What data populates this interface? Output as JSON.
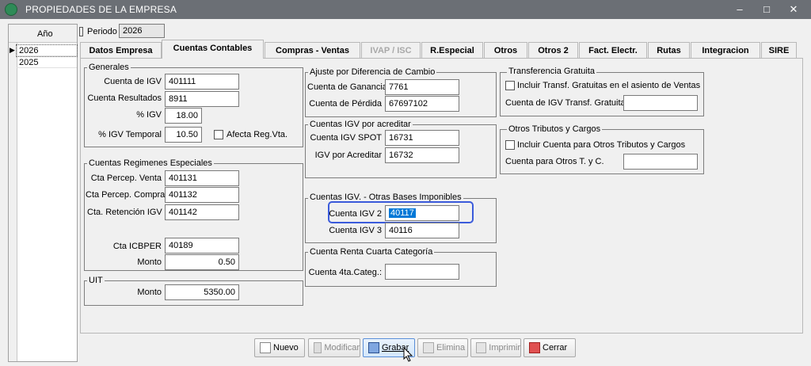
{
  "window": {
    "title": "PROPIEDADES DE LA EMPRESA",
    "controls": [
      "minimize-icon",
      "maximize-icon",
      "close-icon"
    ]
  },
  "years": {
    "header": "Año",
    "rows": [
      "2026",
      "2025"
    ],
    "selected": "2026"
  },
  "periodo": {
    "label": "Periodo",
    "value": "2026"
  },
  "tabs": [
    {
      "label": "Datos Empresa",
      "state": "normal"
    },
    {
      "label": "Cuentas Contables",
      "state": "active"
    },
    {
      "label": "Compras - Ventas",
      "state": "normal"
    },
    {
      "label": "IVAP / ISC",
      "state": "disabled"
    },
    {
      "label": "R.Especial",
      "state": "normal"
    },
    {
      "label": "Otros",
      "state": "normal"
    },
    {
      "label": "Otros 2",
      "state": "normal"
    },
    {
      "label": "Fact. Electr.",
      "state": "normal"
    },
    {
      "label": "Rutas",
      "state": "normal"
    },
    {
      "label": "Integracion",
      "state": "normal"
    },
    {
      "label": "SIRE",
      "state": "normal"
    }
  ],
  "generales": {
    "title": "Generales",
    "cuenta_igv": {
      "label": "Cuenta de IGV",
      "value": "401111"
    },
    "cuenta_resultados": {
      "label": "Cuenta Resultados",
      "value": "8911"
    },
    "pct_igv": {
      "label": "% IGV",
      "value": "18.00"
    },
    "pct_igv_temporal": {
      "label": "% IGV Temporal",
      "value": "10.50"
    },
    "afecta_reg_vta": {
      "label": "Afecta Reg.Vta.",
      "checked": false
    }
  },
  "regimenes": {
    "title": "Cuentas Regimenes Especiales",
    "percep_venta": {
      "label": "Cta Percep. Venta",
      "value": "401131"
    },
    "percep_compra": {
      "label": "Cta Percep. Compra",
      "value": "401132"
    },
    "retencion_igv": {
      "label": "Cta. Retención IGV",
      "value": "401142"
    },
    "icbper": {
      "label": "Cta ICBPER",
      "value": "40189"
    },
    "monto": {
      "label": "Monto",
      "value": "0.50"
    }
  },
  "uit": {
    "title": "UIT",
    "monto": {
      "label": "Monto",
      "value": "5350.00"
    }
  },
  "ajuste": {
    "title": "Ajuste por Diferencia de Cambio",
    "ganancia": {
      "label": "Cuenta de Ganancia",
      "value": "7761"
    },
    "perdida": {
      "label": "Cuenta de Pérdida",
      "value": "67697102"
    }
  },
  "por_acreditar": {
    "title": "Cuentas IGV por acreditar",
    "spot": {
      "label": "Cuenta IGV SPOT",
      "value": "16731"
    },
    "acreditar": {
      "label": "IGV por Acreditar",
      "value": "16732"
    }
  },
  "otras_bases": {
    "title": "Cuentas IGV. - Otras Bases Imponibles",
    "igv2": {
      "label": "Cuenta IGV 2",
      "value": "40117"
    },
    "igv3": {
      "label": "Cuenta IGV 3",
      "value": "40116"
    }
  },
  "renta": {
    "title": "Cuenta Renta Cuarta Categoría",
    "cuarta": {
      "label": "Cuenta 4ta.Categ.:",
      "value": ""
    }
  },
  "transferencia": {
    "title": "Transferencia Gratuita",
    "incluir": {
      "label": "Incluir Transf. Gratuitas en el asiento de Ventas",
      "checked": false
    },
    "cuenta": {
      "label": "Cuenta de IGV Transf. Gratuita",
      "value": ""
    }
  },
  "otros_tributos": {
    "title": "Otros Tributos y Cargos",
    "incluir": {
      "label": "Incluir Cuenta para Otros Tributos y Cargos",
      "checked": false
    },
    "cuenta": {
      "label": "Cuenta para Otros T. y C.",
      "value": ""
    }
  },
  "buttons": {
    "nuevo": "Nuevo",
    "modificar": "Modificar",
    "grabar": "Grabar",
    "elimina": "Elimina",
    "imprimir": "Imprimir",
    "cerrar": "Cerrar"
  },
  "colors": {
    "titlebar": "#6b6f75",
    "selection": "#0078d7",
    "focus_ring": "#3b5bdb"
  }
}
